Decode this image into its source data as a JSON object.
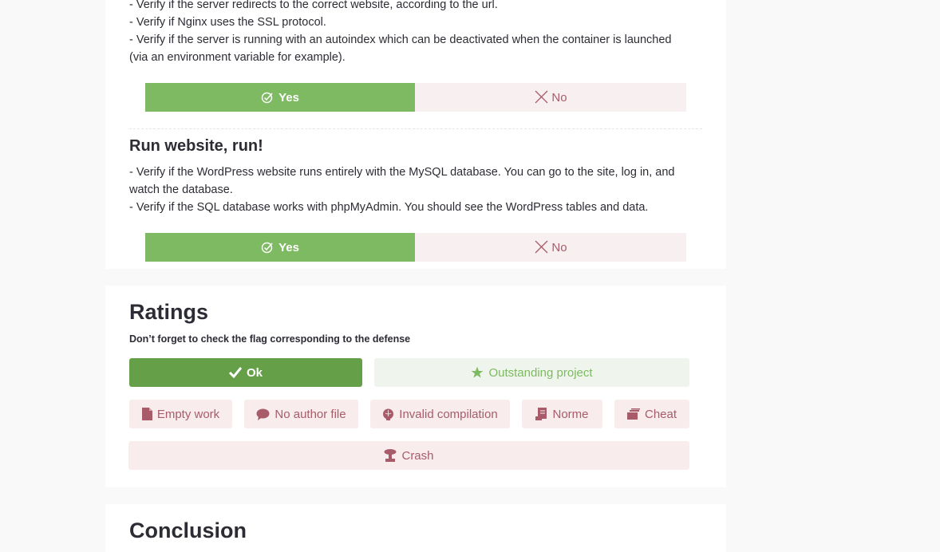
{
  "block1": {
    "lines": [
      "- Verify if the server redirects to the correct website, according to the url.",
      "- Verify if Nginx uses the SSL protocol.",
      "- Verify if the server is running with an autoindex which can be deactivated when the container is launched (via an environment variable for example)."
    ],
    "yes_label": "Yes",
    "no_label": "No"
  },
  "block2": {
    "title": "Run website, run!",
    "lines": [
      "- Verify if the WordPress website runs entirely with the MySQL database. You can go to the site, log in, and watch the database.",
      "- Verify if the SQL database works with phpMyAdmin. You should see the WordPress tables and data."
    ],
    "yes_label": "Yes",
    "no_label": "No"
  },
  "ratings": {
    "title": "Ratings",
    "subtitle": "Don’t forget to check the flag corresponding to the defense",
    "ok_label": "Ok",
    "outstanding_label": "Outstanding project",
    "flags": {
      "empty_work": "Empty work",
      "no_author_file": "No author file",
      "invalid_compilation": "Invalid compilation",
      "norme": "Norme",
      "cheat": "Cheat",
      "crash": "Crash"
    }
  },
  "conclusion": {
    "title": "Conclusion"
  },
  "colors": {
    "accent_green": "#7dba61",
    "ok_green": "#659f47",
    "flag_red": "#a85c6a",
    "flag_bg": "#f8eced"
  }
}
